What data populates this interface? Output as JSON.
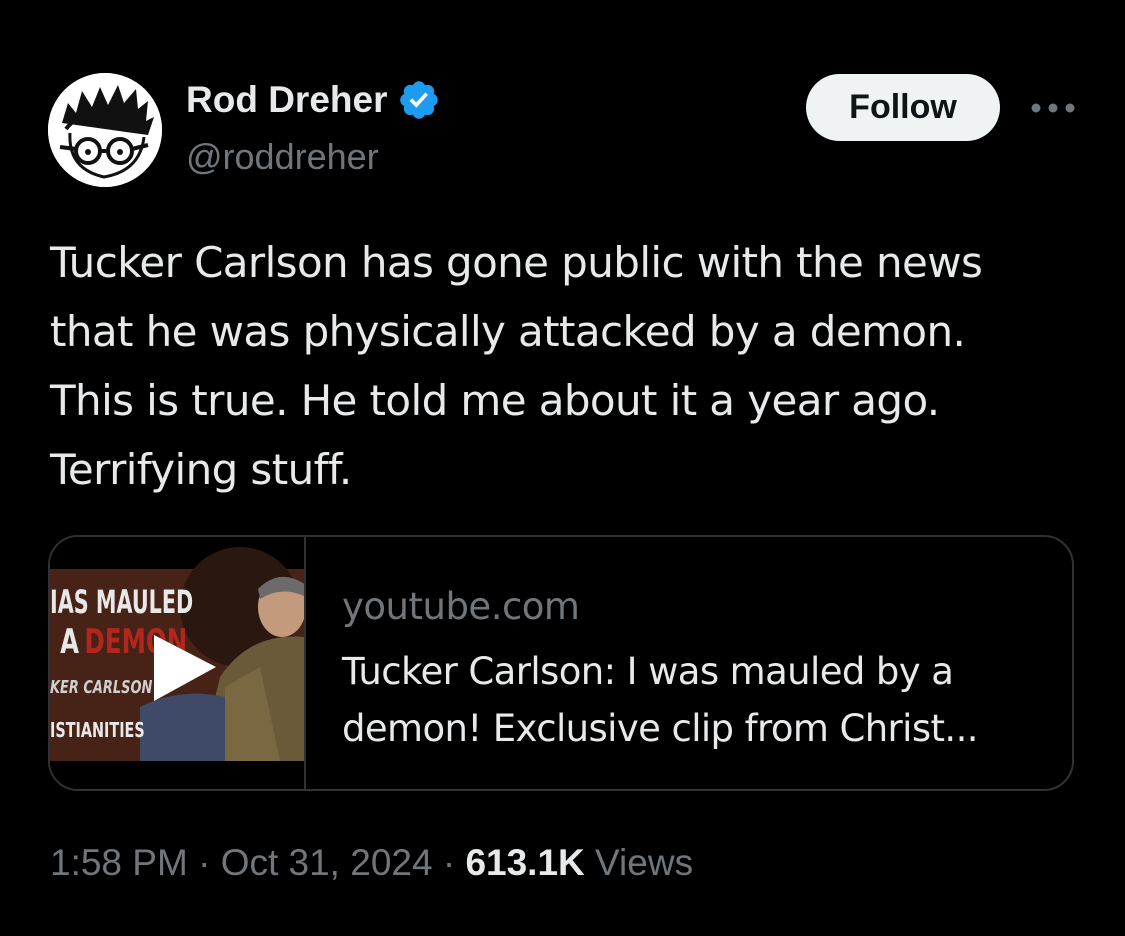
{
  "author": {
    "name": "Rod Dreher",
    "handle": "@roddreher",
    "verified_color": "#1d9bf0"
  },
  "actions": {
    "follow_label": "Follow",
    "more_icon": "more-horizontal-icon"
  },
  "tweet": {
    "lines": [
      "Tucker Carlson has gone public with the news",
      "that he was physically attacked by a demon.",
      "This is true. He told me about it a year ago.",
      "Terrifying stuff."
    ]
  },
  "card": {
    "domain": "youtube.com",
    "title_lines": [
      "Tucker Carlson: I was mauled by a",
      "demon! Exclusive clip from Christ..."
    ],
    "thumbnail": {
      "overlay_lines": [
        "IAS MAULED",
        "A DEMON",
        "KER CARLSON",
        "ISTIANITIES"
      ],
      "icon": "play-icon"
    }
  },
  "meta": {
    "time": "1:58 PM",
    "separator": "·",
    "date": "Oct 31, 2024",
    "views_count": "613.1K",
    "views_label": "Views"
  }
}
